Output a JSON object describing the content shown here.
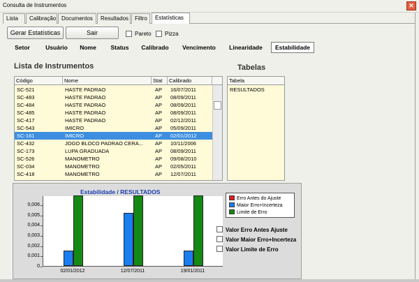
{
  "window": {
    "title": "Consulta de Instrumentos",
    "close_glyph": "✕"
  },
  "top_tabs": [
    "Lista",
    "Calibração",
    "Documentos",
    "Resultados",
    "Filtro",
    "Estatísticas"
  ],
  "toolbar": {
    "gerar": "Gerar Estatísticas",
    "sair": "Sair",
    "pareto": "Pareto",
    "pizza": "Pizza"
  },
  "sub_tabs": [
    "Setor",
    "Usuário",
    "Nome",
    "Status",
    "Calibrado",
    "Vencimento",
    "Linearidade",
    "Estabilidade"
  ],
  "instrumentos": {
    "heading": "Lista de Instrumentos",
    "columns": [
      "Código",
      "Nome",
      "Stat",
      "Calibrado"
    ],
    "rows": [
      [
        "SC-521",
        "HASTE PADRAO",
        "AP",
        "16/07/2011"
      ],
      [
        "SC-483",
        "HASTE PADRAO",
        "AP",
        "08/09/2011"
      ],
      [
        "SC-484",
        "HASTE PADRAO",
        "AP",
        "08/09/2011"
      ],
      [
        "SC-485",
        "HASTE PADRAO",
        "AP",
        "08/09/2011"
      ],
      [
        "SC-417",
        "HASTE PADRAO",
        "AP",
        "02/12/2011"
      ],
      [
        "SC-543",
        "IMICRO",
        "AP",
        "05/09/2011"
      ],
      [
        "SC-161",
        "IMICRO",
        "AP",
        "02/01/2012"
      ],
      [
        "SC-432",
        "JOGO BLOCO PADRAO CERA...",
        "AP",
        "10/11/2006"
      ],
      [
        "SC-173",
        "LUPA GRADUADA",
        "AP",
        "08/09/2011"
      ],
      [
        "SC-526",
        "MANOMETRO",
        "AP",
        "09/08/2010"
      ],
      [
        "SC-034",
        "MANOMETRO",
        "AP",
        "02/05/2011"
      ],
      [
        "SC-418",
        "MANOMETRO",
        "AP",
        "12/07/2011"
      ]
    ],
    "selected_index": 6
  },
  "tabelas": {
    "heading": "Tabelas",
    "column": "Tabela",
    "rows": [
      "RESULTADOS"
    ]
  },
  "chart_data": {
    "type": "bar",
    "title": "Estabilidade / RESULTADOS",
    "categories": [
      "02/01/2012",
      "12/07/2011",
      "19/01/2011"
    ],
    "series": [
      {
        "name": "Erro Antes do Ajuste",
        "color": "#e02020",
        "values": [
          0,
          0,
          0
        ]
      },
      {
        "name": "Maior Erro+Incerteza",
        "color": "#1a7ef0",
        "values": [
          0.0015,
          0.0052,
          0.0015
        ]
      },
      {
        "name": "Limite de Erro",
        "color": "#148a14",
        "values": [
          0.0069,
          0.0069,
          0.0069
        ]
      }
    ],
    "yticks": [
      "0,006",
      "0,005",
      "0,004",
      "0,003",
      "0,002",
      "0,001",
      "0"
    ],
    "ylim": [
      0,
      0.0069
    ],
    "legend_position": "top-right"
  },
  "chart_options": [
    "Valor Erro Antes Ajuste",
    "Valor Maior Erro+Incerteza",
    "Valor Limite de Erro"
  ]
}
